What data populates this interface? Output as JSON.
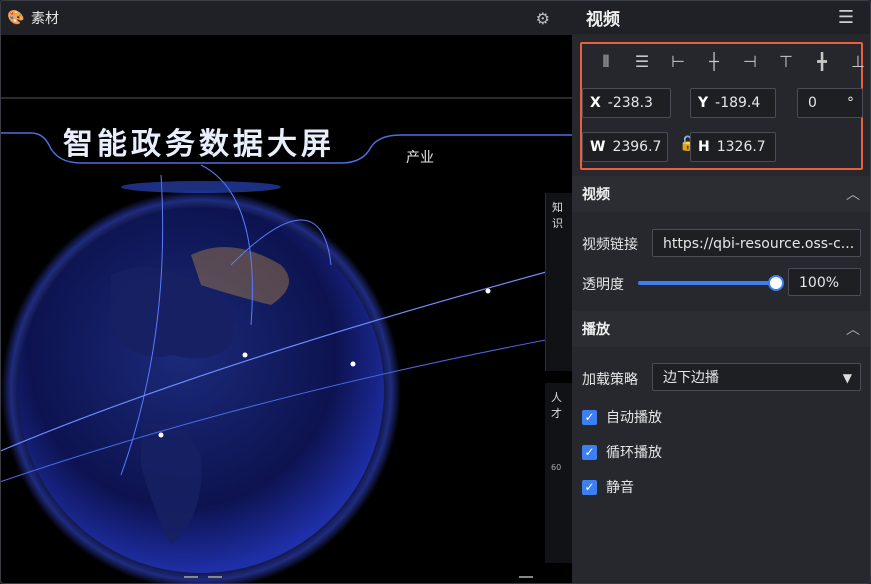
{
  "left_panel": {
    "title": "素材",
    "palette_icon": "palette-icon",
    "settings_icon": "gear-icon",
    "canvas": {
      "main_title": "智能政务数据大屏",
      "subtitle": "产业",
      "side_panel_1_label": "知识",
      "side_panel_2_label": "人才",
      "side_panel_2_tick": "60"
    }
  },
  "right_panel": {
    "header": {
      "title": "视频",
      "menu_icon": "panel-collapse-icon"
    },
    "geometry": {
      "align_icons": [
        "align-distribute-horizontal-icon",
        "align-distribute-vertical-icon",
        "align-left-icon",
        "align-center-horizontal-icon",
        "align-right-icon",
        "align-top-icon",
        "align-center-vertical-icon",
        "align-bottom-icon"
      ],
      "x": {
        "label": "X",
        "value": "-238.3"
      },
      "y": {
        "label": "Y",
        "value": "-189.4"
      },
      "rotation": {
        "value": "0",
        "unit": "°"
      },
      "w": {
        "label": "W",
        "value": "2396.7"
      },
      "h": {
        "label": "H",
        "value": "1326.7"
      }
    },
    "video_section": {
      "title": "视频",
      "link_label": "视频链接",
      "link_value": "https://qbi-resource.oss-c...",
      "opacity_label": "透明度",
      "opacity_value": "100%",
      "opacity_fraction": 1.0
    },
    "play_section": {
      "title": "播放",
      "load_label": "加载策略",
      "load_value": "边下边播",
      "autoplay_label": "自动播放",
      "loop_label": "循环播放",
      "mute_label": "静音",
      "autoplay_checked": true,
      "loop_checked": true,
      "mute_checked": true
    }
  },
  "colors": {
    "accent": "#3d7ff0",
    "highlight_border": "#e8613c"
  }
}
